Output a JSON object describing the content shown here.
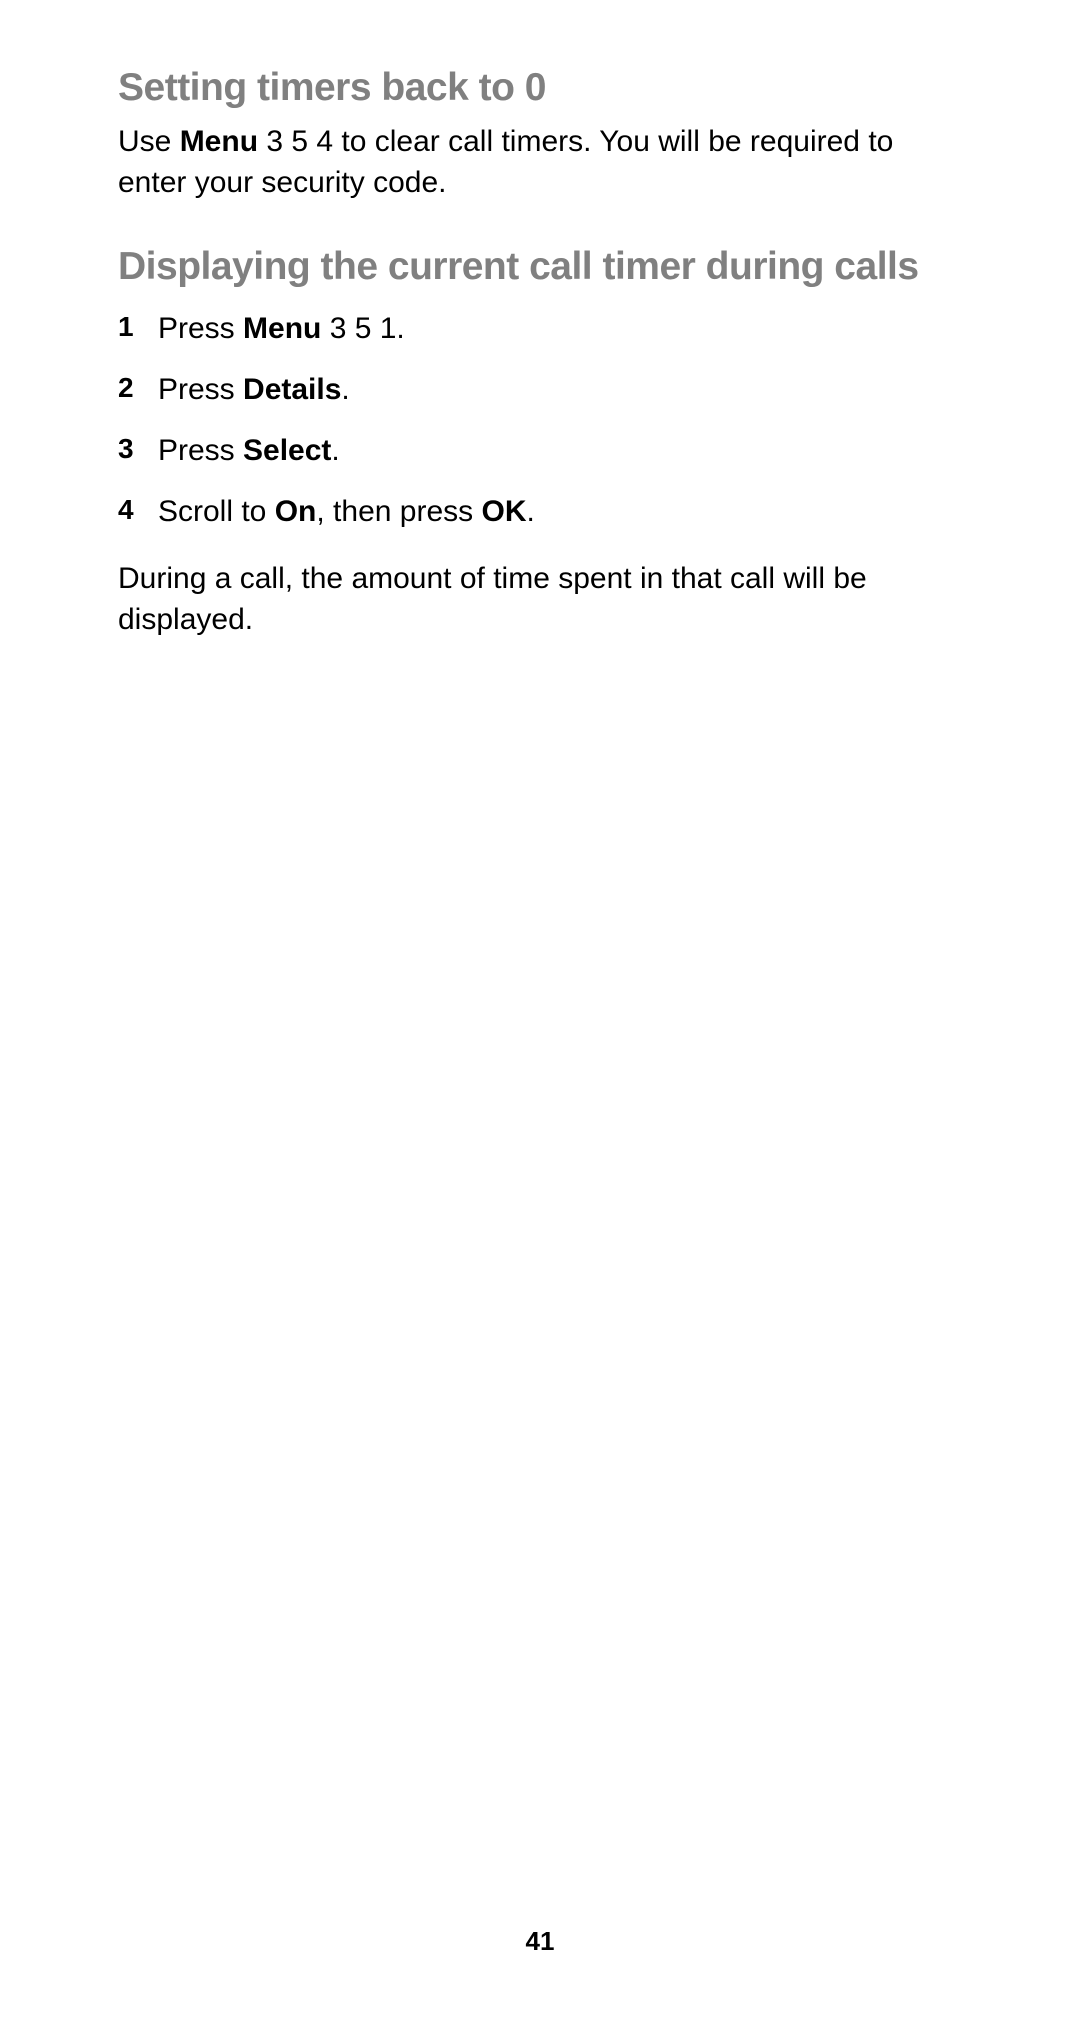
{
  "section1": {
    "heading": "Setting timers back to 0",
    "para_pre": "Use ",
    "para_bold1": "Menu",
    "para_post": " 3 5 4 to clear call timers. You will be required to enter your security code."
  },
  "section2": {
    "heading": "Displaying the current call timer during calls",
    "items": [
      {
        "num": "1",
        "pre": "Press ",
        "bold1": "Menu",
        "post1": " 3 5 1."
      },
      {
        "num": "2",
        "pre": "Press ",
        "bold1": "Details",
        "post1": "."
      },
      {
        "num": "3",
        "pre": "Press ",
        "bold1": "Select",
        "post1": "."
      },
      {
        "num": "4",
        "pre": "Scroll to ",
        "bold1": "On",
        "post1": ", then press ",
        "bold2": "OK",
        "post2": "."
      }
    ],
    "closing": "During a call, the amount of time spent in that call will be displayed."
  },
  "page_number": "41"
}
